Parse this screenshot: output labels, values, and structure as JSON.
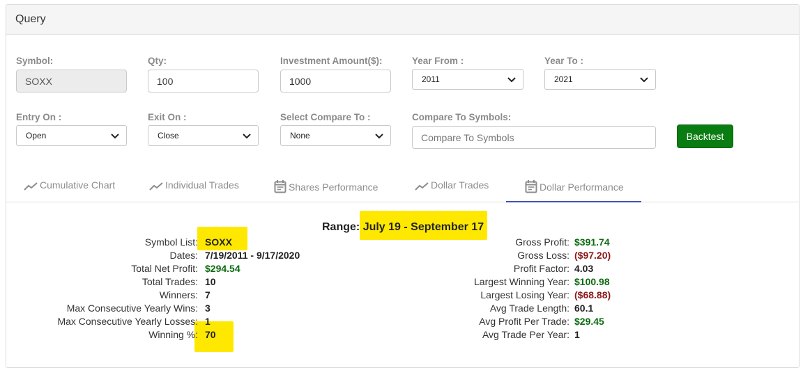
{
  "card": {
    "title": "Query"
  },
  "form": {
    "symbol": {
      "label": "Symbol:",
      "value": "SOXX"
    },
    "qty": {
      "label": "Qty:",
      "value": "100"
    },
    "investment": {
      "label": "Investment Amount($):",
      "value": "1000"
    },
    "year_from": {
      "label": "Year From :",
      "value": "2011"
    },
    "year_to": {
      "label": "Year To :",
      "value": "2021"
    },
    "entry_on": {
      "label": "Entry On :",
      "value": "Open"
    },
    "exit_on": {
      "label": "Exit On :",
      "value": "Close"
    },
    "compare_to": {
      "label": "Select Compare To :",
      "value": "None"
    },
    "compare_symbols": {
      "label": "Compare To Symbols:",
      "placeholder": "Compare To Symbols"
    },
    "backtest_label": "Backtest"
  },
  "tabs": [
    {
      "label": "Cumulative Chart",
      "icon": "trend-line-icon"
    },
    {
      "label": "Individual Trades",
      "icon": "trend-line-icon"
    },
    {
      "label": "Shares Performance",
      "icon": "calendar-icon"
    },
    {
      "label": "Dollar Trades",
      "icon": "trend-line-icon"
    },
    {
      "label": "Dollar Performance",
      "icon": "calendar-icon",
      "active": true
    }
  ],
  "results": {
    "range_label": "Range:",
    "range_value": "July 19 - September 17",
    "left": [
      {
        "label": "Symbol List:",
        "value": "SOXX"
      },
      {
        "label": "Dates:",
        "value": "7/19/2011 - 9/17/2020"
      },
      {
        "label": "Total Net Profit:",
        "value": "$294.54"
      },
      {
        "label": "Total Trades:",
        "value": "10"
      },
      {
        "label": "Winners:",
        "value": "7"
      },
      {
        "label": "Max Consecutive Yearly Wins:",
        "value": "3"
      },
      {
        "label": "Max Consecutive Yearly Losses:",
        "value": "1"
      },
      {
        "label": "Winning %:",
        "value": "70"
      }
    ],
    "right": [
      {
        "label": "Gross Profit:",
        "value": "$391.74"
      },
      {
        "label": "Gross Loss:",
        "value": "($97.20)"
      },
      {
        "label": "Profit Factor:",
        "value": "4.03"
      },
      {
        "label": "Largest Winning Year:",
        "value": "$100.98"
      },
      {
        "label": "Largest Losing Year:",
        "value": "($68.88)"
      },
      {
        "label": "Avg Trade Length:",
        "value": "60.1"
      },
      {
        "label": "Avg Profit Per Trade:",
        "value": "$29.45"
      },
      {
        "label": "Avg Trade Per Year:",
        "value": "1"
      }
    ]
  },
  "colors": {
    "positive": "#0b6b0f",
    "negative": "#8b1a1a",
    "highlight": "#ffe800",
    "button": "#0a7d12",
    "active_tab": "#3f51b5"
  }
}
